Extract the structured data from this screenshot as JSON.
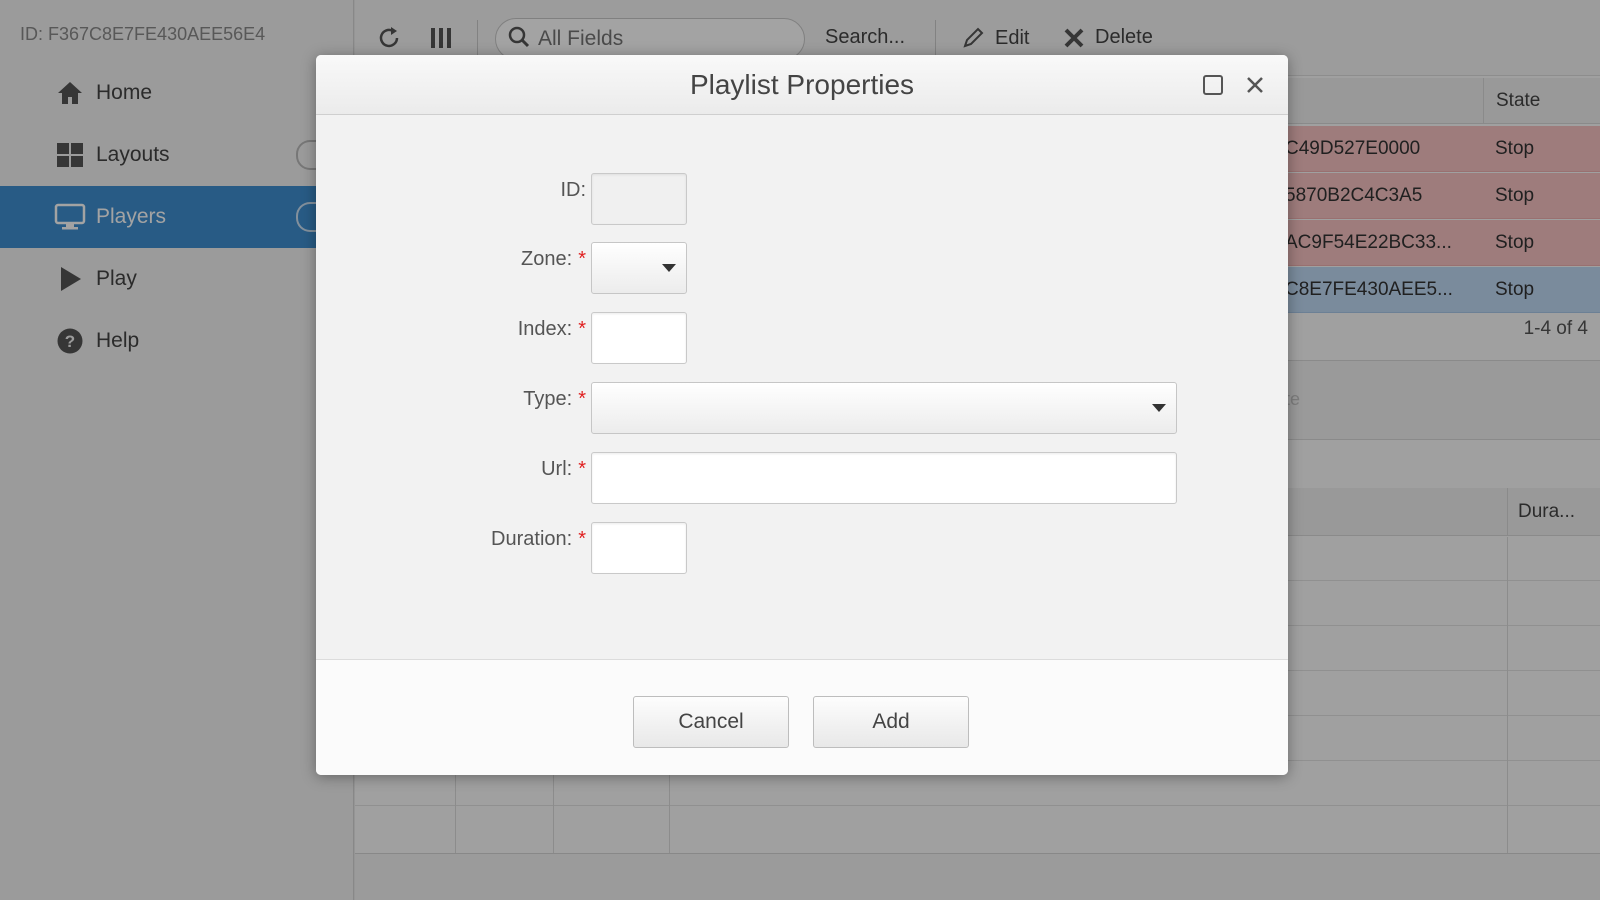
{
  "sidebar": {
    "device_id": "ID: F367C8E7FE430AEE56E4",
    "items": [
      {
        "label": "Home",
        "icon": "home-icon"
      },
      {
        "label": "Layouts",
        "icon": "grid-icon"
      },
      {
        "label": "Players",
        "icon": "monitor-icon",
        "active": true
      },
      {
        "label": "Play",
        "icon": "play-icon"
      },
      {
        "label": "Help",
        "icon": "help-icon"
      }
    ]
  },
  "toolbar": {
    "search_placeholder": "All Fields",
    "search_label": "Search...",
    "edit_label": "Edit",
    "delete_label": "Delete"
  },
  "players_grid": {
    "state_header": "State",
    "rows": [
      {
        "id": "C49D527E0000",
        "state": "Stop",
        "status": "error"
      },
      {
        "id": "5870B2C4C3A5",
        "state": "Stop",
        "status": "error"
      },
      {
        "id": "AC9F54E22BC33...",
        "state": "Stop",
        "status": "error"
      },
      {
        "id": "C8E7FE430AEE5...",
        "state": "Stop",
        "status": "selected"
      }
    ],
    "pager": "1-4 of 4"
  },
  "playlist_grid": {
    "faint_text": "te",
    "duration_header": "Dura..."
  },
  "dialog": {
    "title": "Playlist Properties",
    "fields": {
      "id": {
        "label": "ID:",
        "value": ""
      },
      "zone": {
        "label": "Zone:",
        "value": ""
      },
      "index": {
        "label": "Index:",
        "value": ""
      },
      "type": {
        "label": "Type:",
        "value": ""
      },
      "url": {
        "label": "Url:",
        "value": ""
      },
      "duration": {
        "label": "Duration:",
        "value": ""
      }
    },
    "required_marker": "*",
    "cancel_label": "Cancel",
    "add_label": "Add"
  },
  "colors": {
    "accent": "#3f8fd0",
    "error_row": "#f7c3c3",
    "selected_row": "#bfd9f5",
    "required": "#e02020"
  }
}
